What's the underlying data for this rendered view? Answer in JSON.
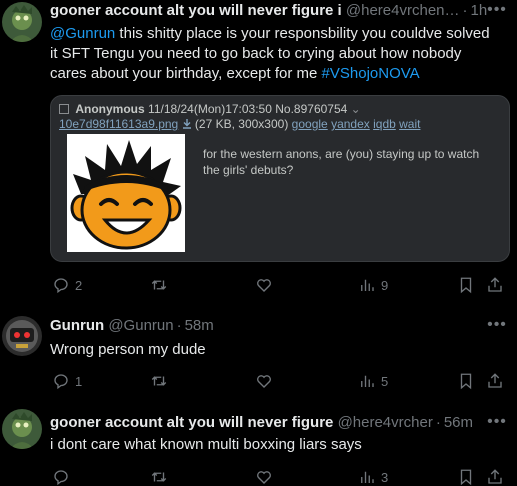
{
  "tweets": [
    {
      "name": "gooner account alt you will never figure i",
      "handle": "@here4vrchen…",
      "sep": "·",
      "time": "1h",
      "mention": "@Gunrun",
      "text": " this shitty place is your responsbility you couldve solved it SFT Tengu you need to go back to crying about how nobody cares about your birthday, except for me ",
      "hashtag": "#VShojoNOVA",
      "replies": "2",
      "retweets": "",
      "likes": "",
      "views": "9"
    },
    {
      "name": "Gunrun",
      "handle": "@Gunrun",
      "sep": "·",
      "time": "58m",
      "text": "Wrong person my dude",
      "replies": "1",
      "retweets": "",
      "likes": "",
      "views": "5"
    },
    {
      "name": "gooner account alt you will never figure",
      "handle": "@here4vrcher",
      "sep": "·",
      "time": "56m",
      "text": "i dont care what known multi boxxing liars says",
      "replies": "",
      "retweets": "",
      "likes": "",
      "views": "3"
    }
  ],
  "quote": {
    "poster": "Anonymous",
    "datetime": "11/18/24(Mon)17:03:50",
    "post_no": "No.89760754",
    "caret": "⌄",
    "filename": "10e7d98f11613a9.png",
    "fileinfo": "(27 KB, 300x300)",
    "links": [
      "google",
      "yandex",
      "iqdb",
      "wait"
    ],
    "comment": "for the western anons, are (you) staying up to watch the girls' debuts?"
  },
  "icons": [
    "reply-icon",
    "retweet-icon",
    "like-icon",
    "views-icon",
    "bookmark-icon",
    "share-icon",
    "more-icon",
    "download-icon"
  ],
  "colors": {
    "accent": "#1d9bf0",
    "muted": "#71767b",
    "text": "#e7e9ea",
    "quote_bg": "#282a2d",
    "quote_link": "#81a2be"
  }
}
